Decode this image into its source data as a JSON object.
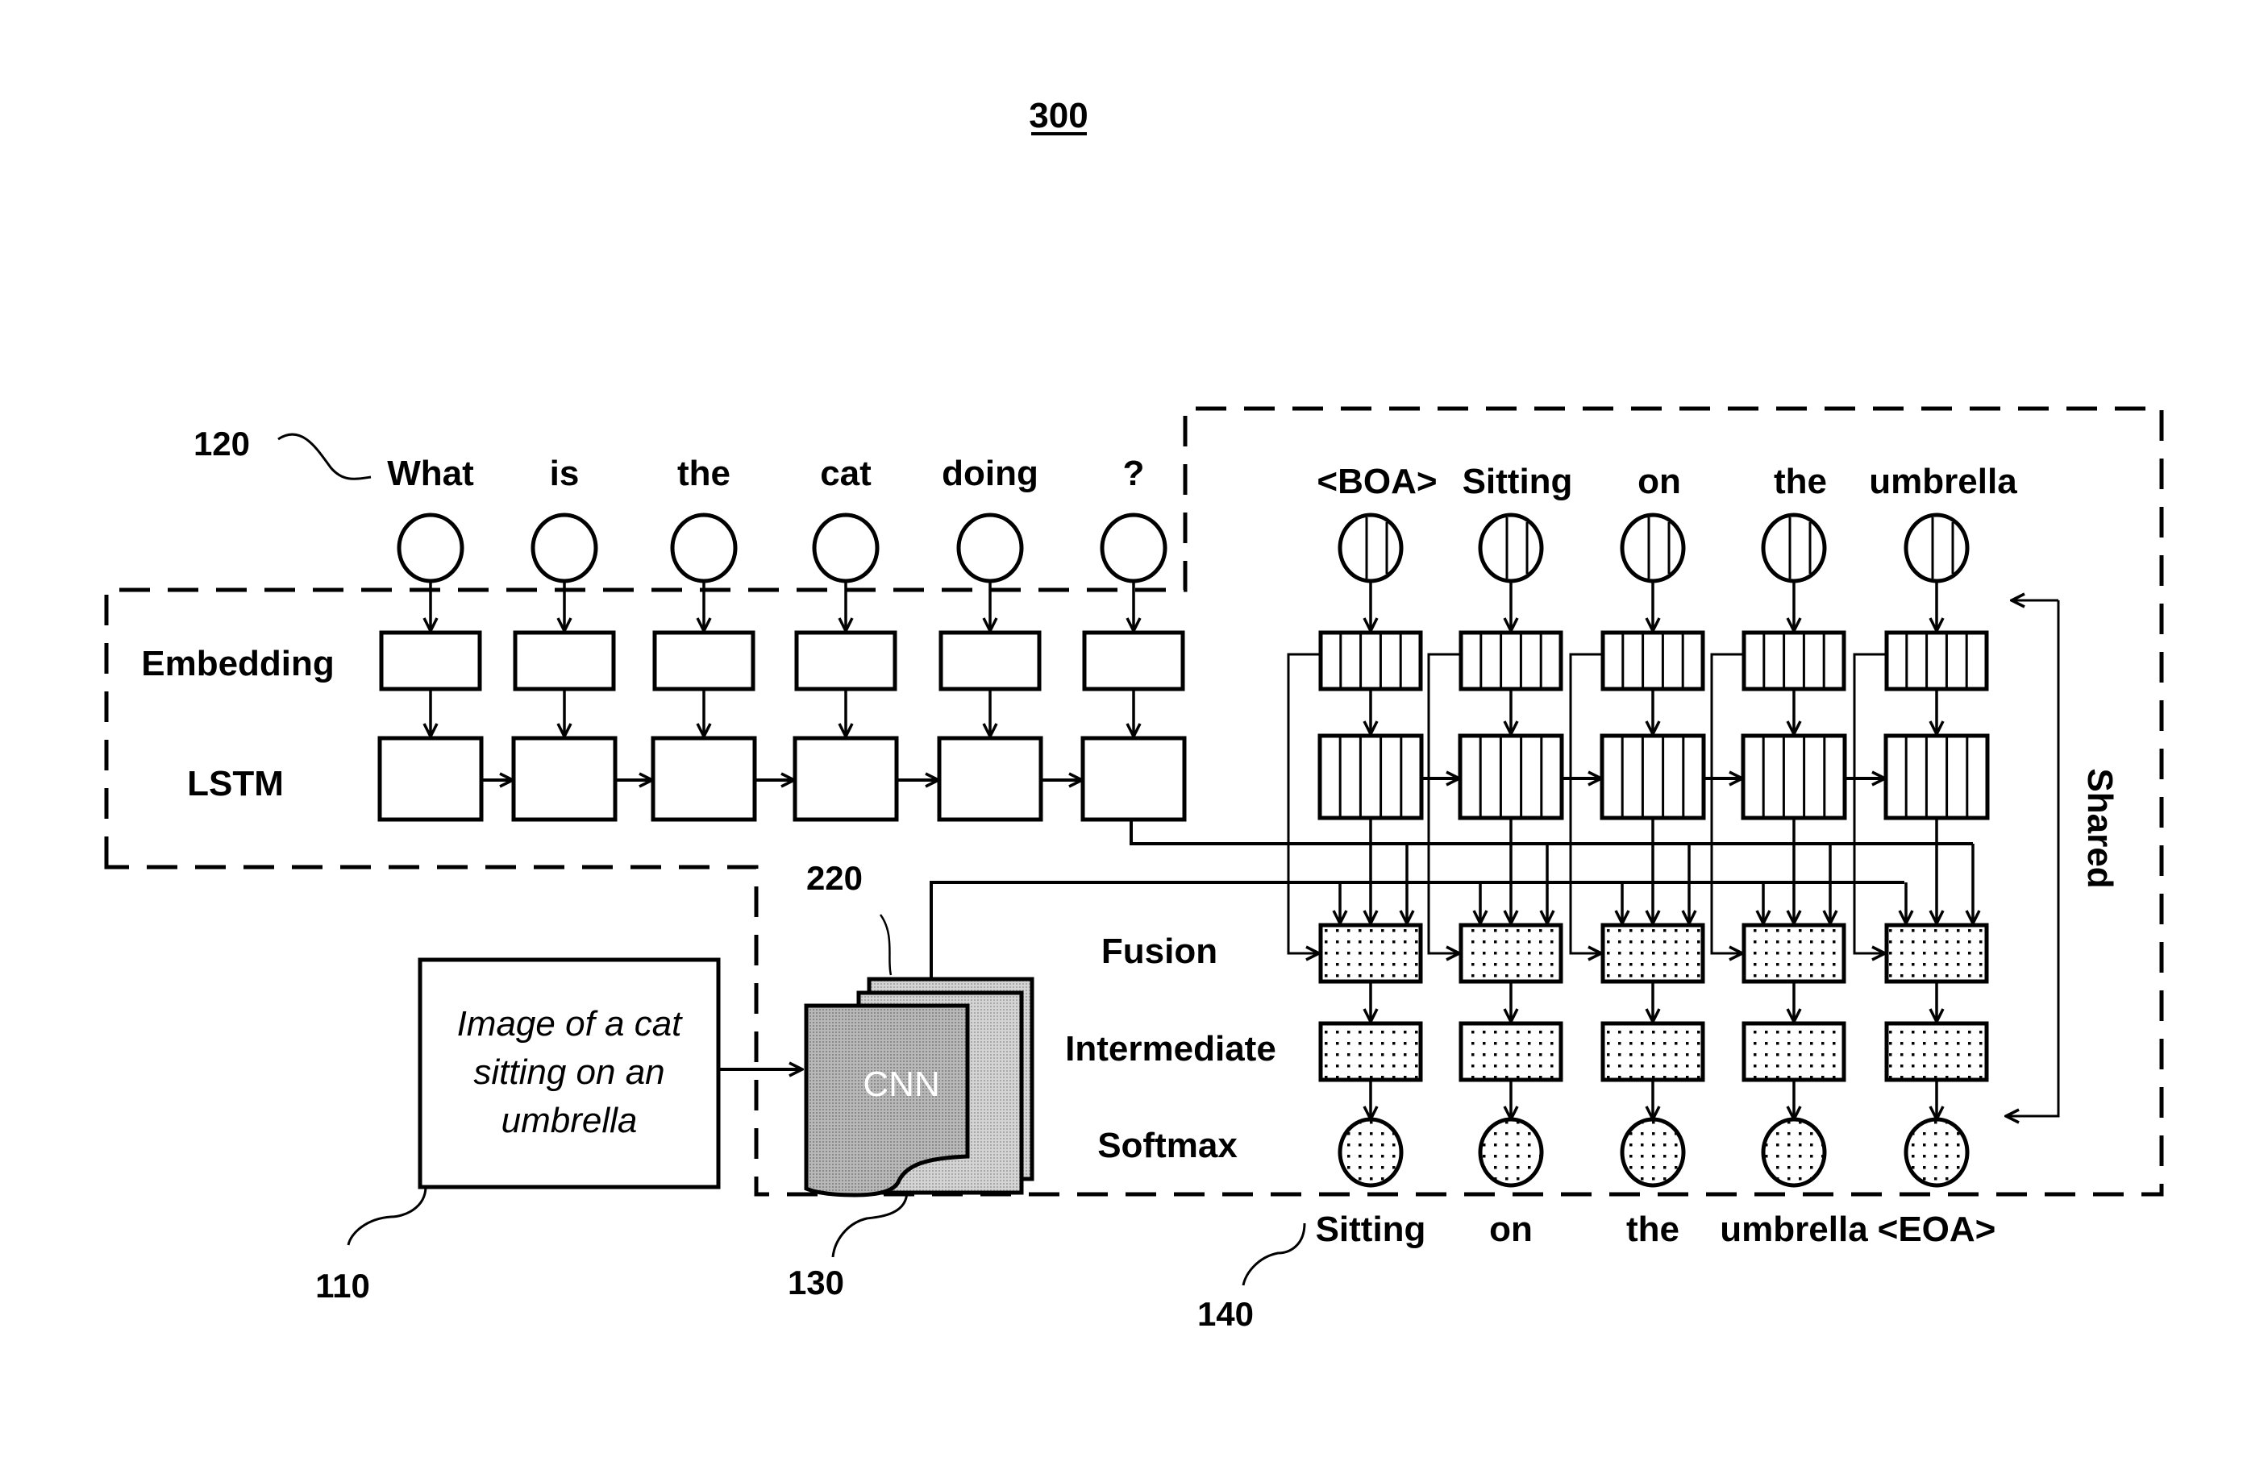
{
  "figure": {
    "number": "300",
    "refs": {
      "image_input": "110",
      "question_encoder": "120",
      "cnn": "130",
      "answer_decoder": "140",
      "feature_maps": "220"
    }
  },
  "question": {
    "tokens": [
      "What",
      "is",
      "the",
      "cat",
      "doing",
      "?"
    ],
    "row_labels": {
      "embedding": "Embedding",
      "lstm": "LSTM"
    }
  },
  "image": {
    "description_lines": [
      "Image of a cat",
      "sitting on an",
      "umbrella"
    ],
    "cnn_label": "CNN"
  },
  "answer": {
    "input_tokens": [
      "<BOA>",
      "Sitting",
      "on",
      "the",
      "umbrella"
    ],
    "output_tokens": [
      "Sitting",
      "on",
      "the",
      "umbrella",
      "<EOA>"
    ],
    "row_labels": {
      "fusion": "Fusion",
      "intermediate": "Intermediate",
      "softmax": "Softmax"
    },
    "shared_label": "Shared"
  }
}
